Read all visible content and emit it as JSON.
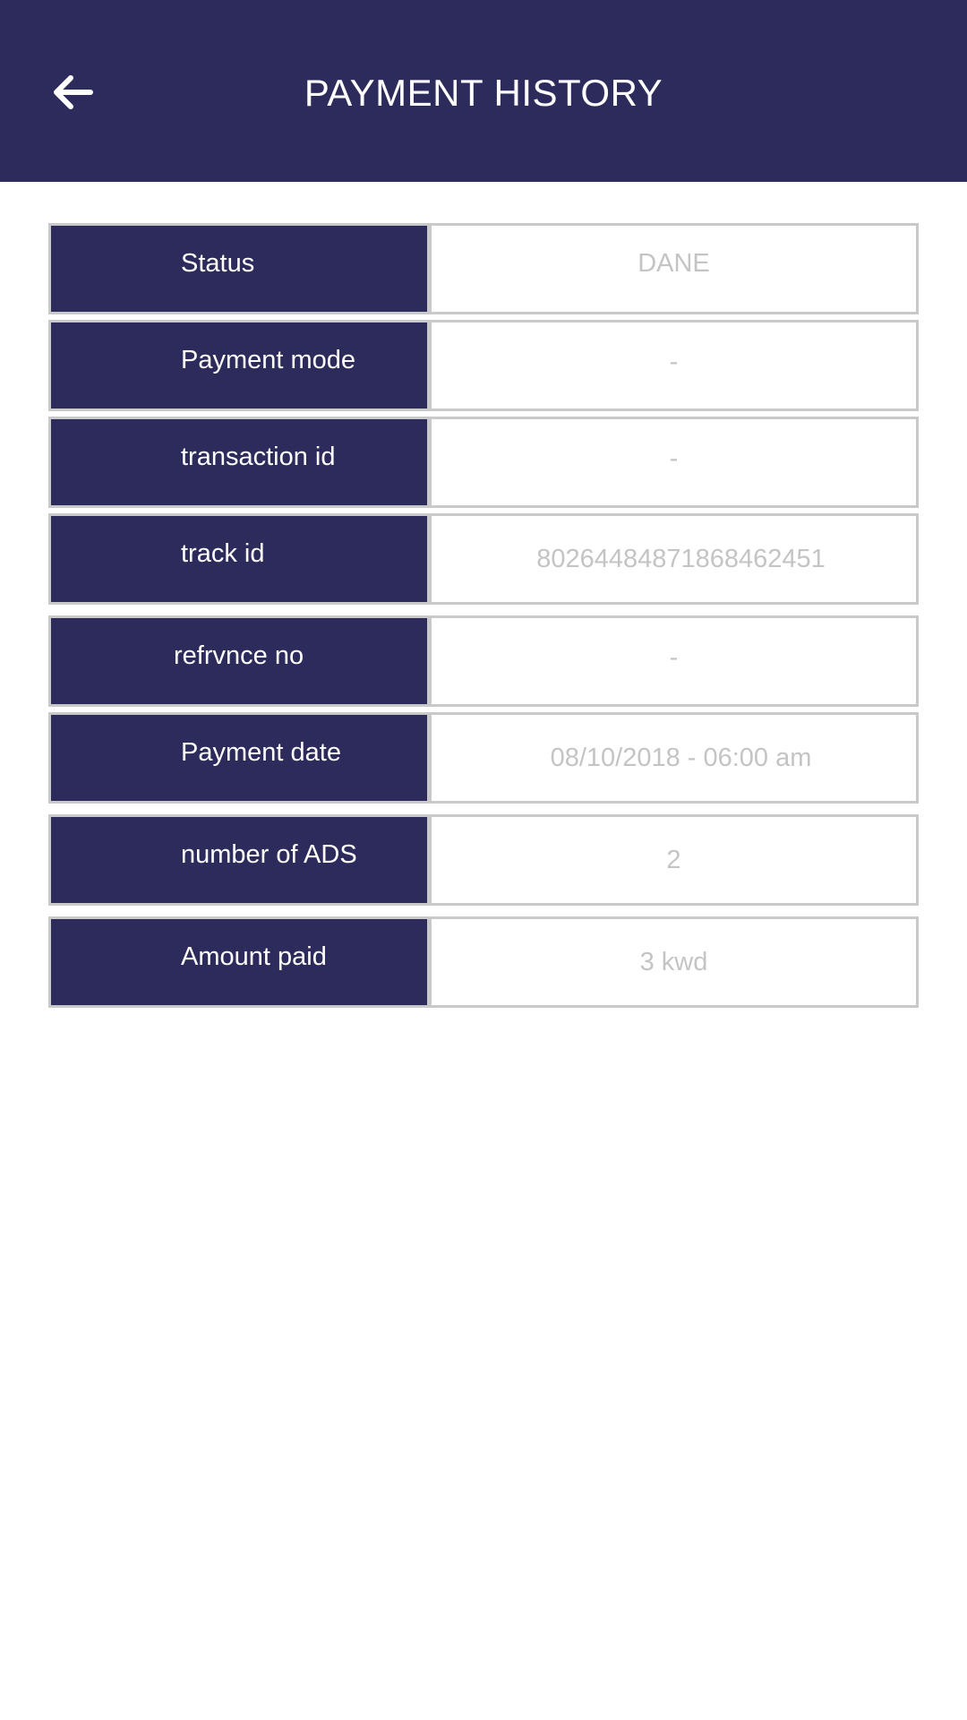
{
  "header": {
    "title": "PAYMENT HISTORY",
    "back_icon": "arrow-left-icon",
    "background_color": "#2c2b5b"
  },
  "details": {
    "rows": [
      {
        "label": "Status",
        "value": "DANE"
      },
      {
        "label": "Payment mode",
        "value": "-"
      },
      {
        "label": "transaction id",
        "value": "-"
      },
      {
        "label": "track id",
        "value": "80264484871868462451"
      },
      {
        "label": "refrvnce no",
        "value": "-"
      },
      {
        "label": "Payment date",
        "value": "08/10/2018 - 06:00 am"
      },
      {
        "label": "number of ADS",
        "value": "2"
      },
      {
        "label": "Amount paid",
        "value": "3 kwd"
      }
    ]
  }
}
